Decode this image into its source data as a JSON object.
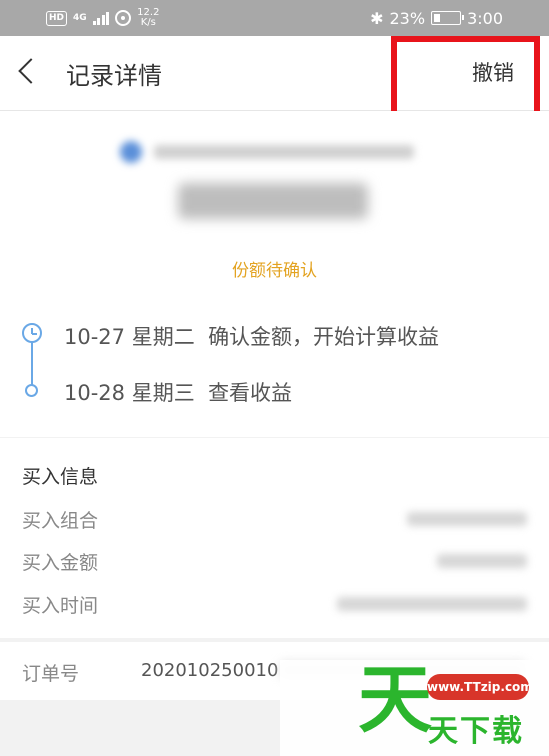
{
  "status_bar": {
    "hd": "HD",
    "network": "4G",
    "speed": "12.2",
    "speed_unit": "K/s",
    "battery": "23%",
    "time": "3:00"
  },
  "header": {
    "title": "记录详情",
    "revoke_label": "撤销"
  },
  "summary": {
    "status": "份额待确认",
    "timeline": [
      {
        "date": "10-27 星期二",
        "text": "确认金额，开始计算收益"
      },
      {
        "date": "10-28 星期三",
        "text": "查看收益"
      }
    ]
  },
  "buy_info": {
    "title": "买入信息",
    "rows": [
      {
        "label": "买入组合"
      },
      {
        "label": "买入金额"
      },
      {
        "label": "买入时间"
      }
    ]
  },
  "order": {
    "label": "订单号",
    "value": "202010250010"
  },
  "watermark": {
    "big_char": "天",
    "url": "www.TTzip.com",
    "text": "天下载"
  }
}
